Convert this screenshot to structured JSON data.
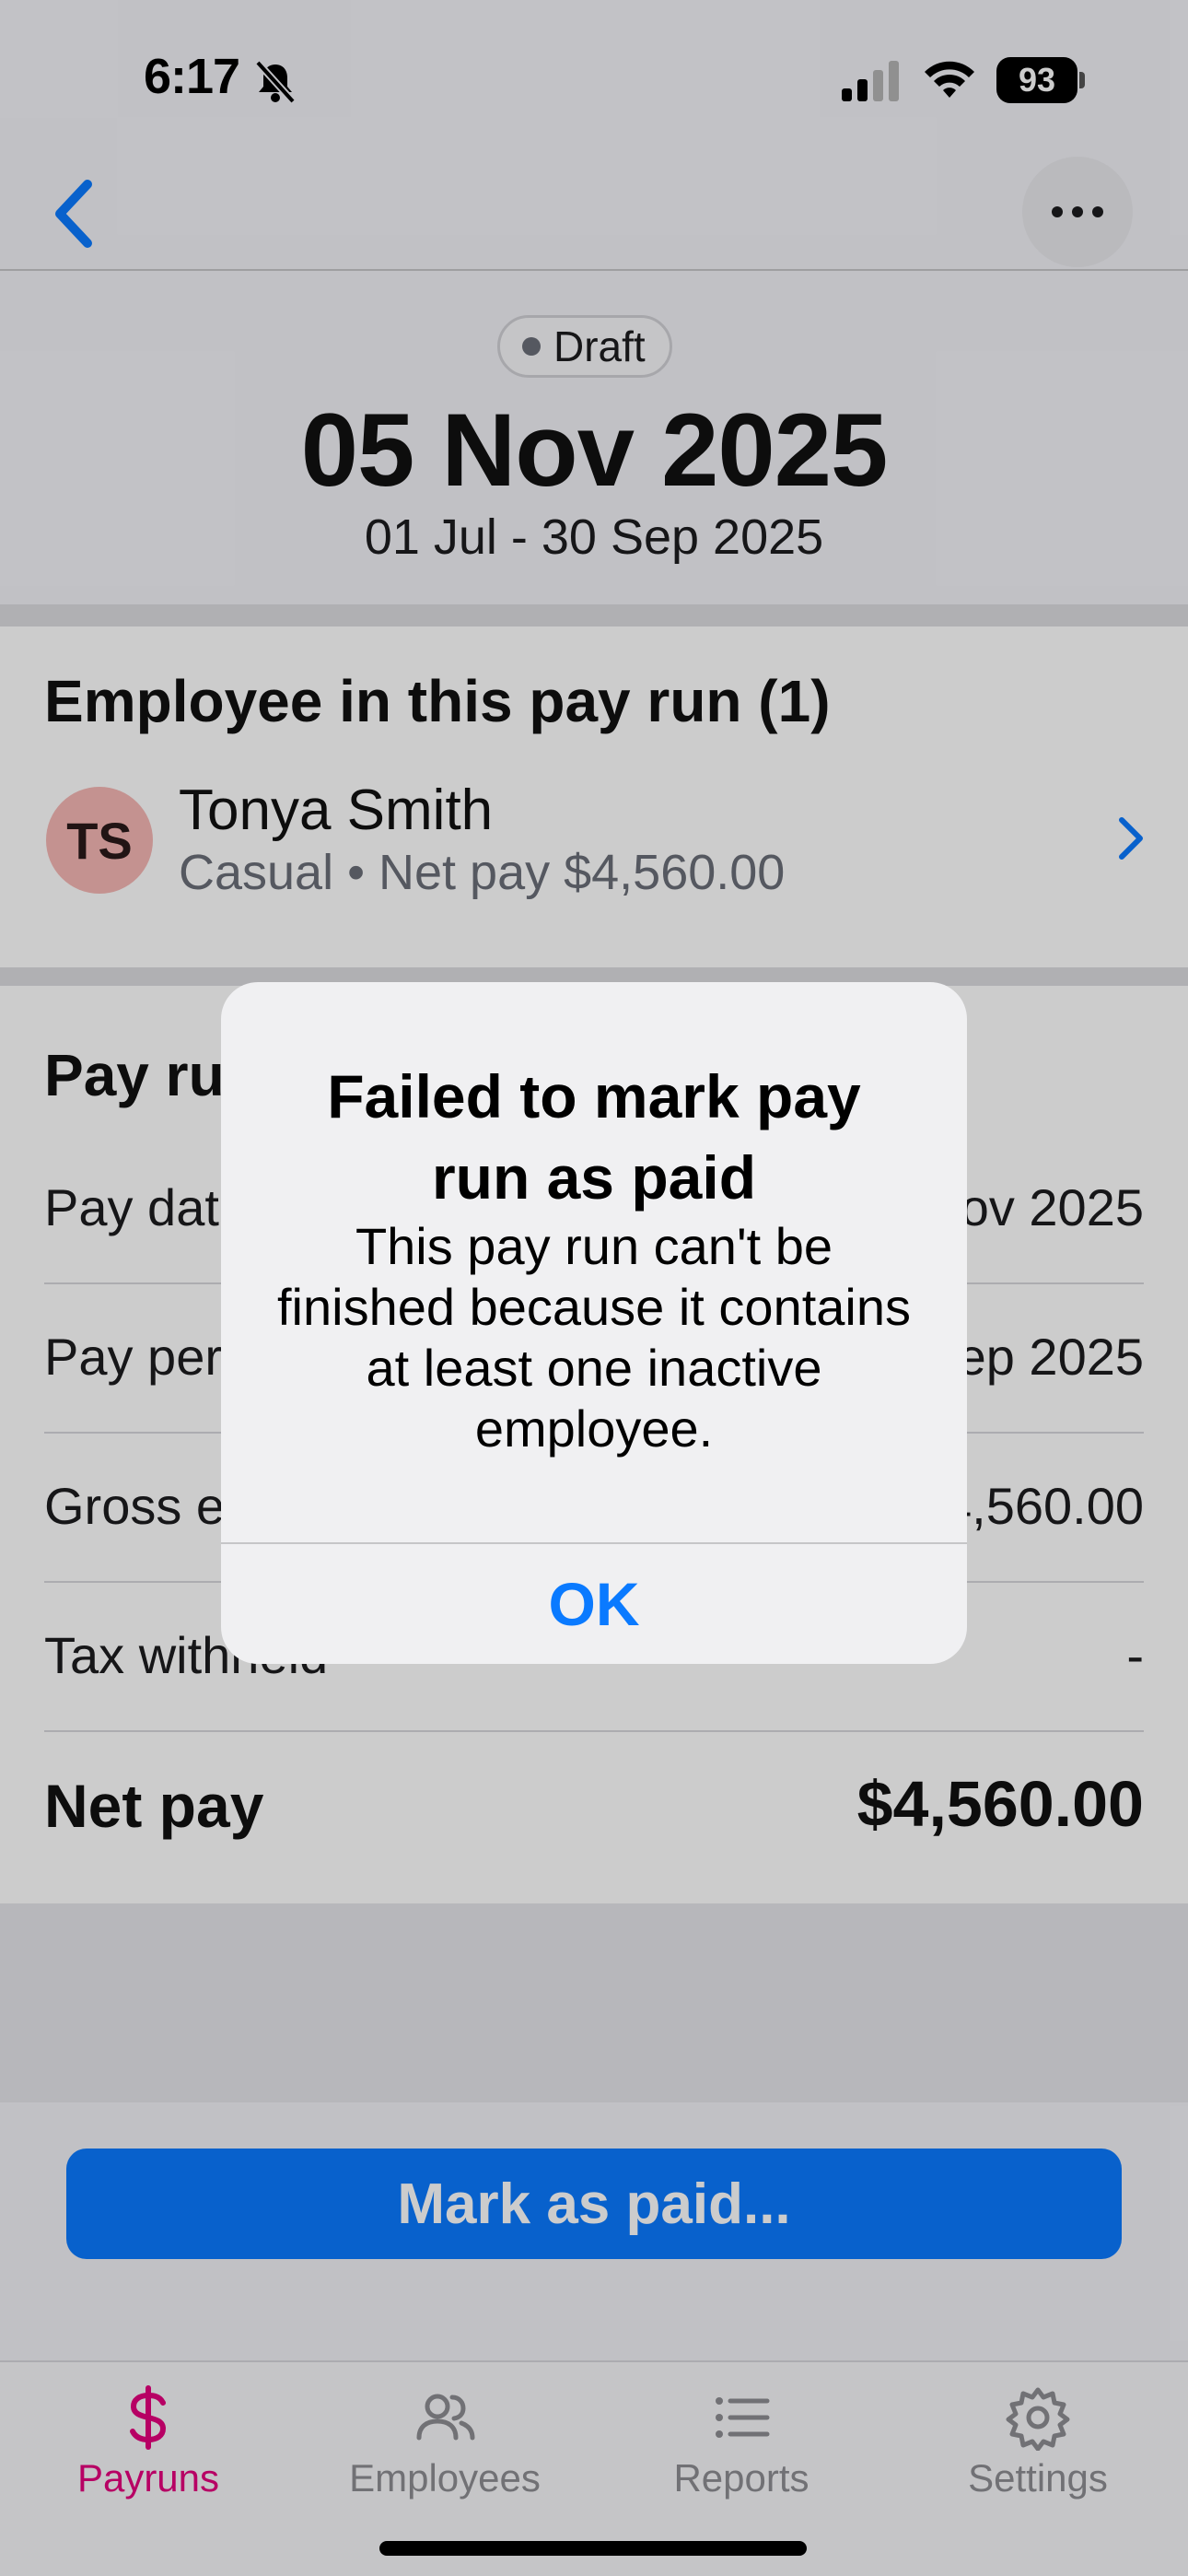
{
  "status_bar": {
    "time": "6:17",
    "battery": "93"
  },
  "header": {
    "status_badge": "Draft",
    "pay_date": "05 Nov 2025",
    "period": "01 Jul - 30 Sep 2025"
  },
  "employees_section": {
    "heading": "Employee in this pay run (1)",
    "employees": [
      {
        "initials": "TS",
        "name": "Tonya Smith",
        "detail": "Casual • Net pay $4,560.00"
      }
    ]
  },
  "summary": {
    "heading": "Pay run",
    "rows": [
      {
        "label": "Pay date",
        "value": "05 Nov 2025"
      },
      {
        "label": "Pay period",
        "value": "01 Jul - 30 Sep 2025"
      },
      {
        "label": "Gross earnings",
        "value": "$4,560.00"
      },
      {
        "label": "Tax withheld",
        "value": "-"
      }
    ],
    "net_pay_label": "Net pay",
    "net_pay_value": "$4,560.00"
  },
  "action_button": "Mark as paid...",
  "tabs": [
    {
      "label": "Payruns",
      "icon": "dollar-icon",
      "active": true
    },
    {
      "label": "Employees",
      "icon": "people-icon",
      "active": false
    },
    {
      "label": "Reports",
      "icon": "list-icon",
      "active": false
    },
    {
      "label": "Settings",
      "icon": "gear-icon",
      "active": false
    }
  ],
  "alert": {
    "title": "Failed to mark pay run as paid",
    "message": "This pay run can't be finished because it contains at least one inactive employee.",
    "ok_label": "OK"
  },
  "colors": {
    "accent": "#0a7aff",
    "active_tab": "#e5007e",
    "avatar": "#f6b7b4"
  }
}
